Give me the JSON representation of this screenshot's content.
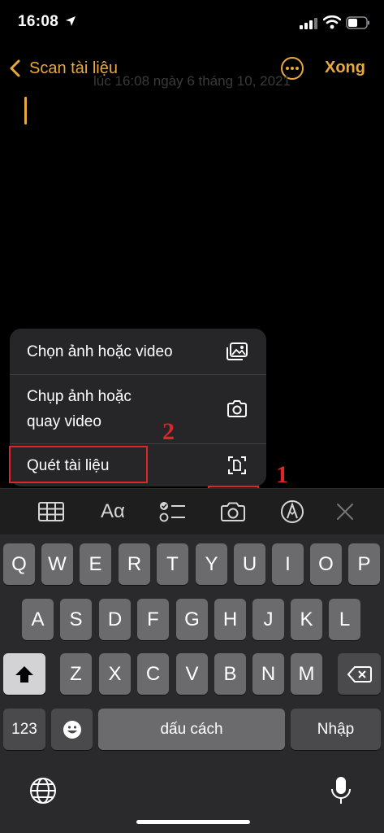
{
  "status_bar": {
    "time": "16:08"
  },
  "nav": {
    "back_label": "Scan tài liệu",
    "done_label": "Xong"
  },
  "note": {
    "date_text": "lúc 16:08 ngày 6 tháng 10, 2021"
  },
  "menu": {
    "items": [
      {
        "label": "Chọn ảnh hoặc video",
        "icon": "photo-library-icon"
      },
      {
        "label": "Chụp ảnh hoặc\nquay video",
        "icon": "camera-icon"
      },
      {
        "label": "Quét tài liệu",
        "icon": "scan-document-icon"
      }
    ]
  },
  "annotations": {
    "step1": "1",
    "step2": "2",
    "color": "#e0242b"
  },
  "toolbar": {
    "format_label": "Aα"
  },
  "keyboard": {
    "row1": [
      "Q",
      "W",
      "E",
      "R",
      "T",
      "Y",
      "U",
      "I",
      "O",
      "P"
    ],
    "row2": [
      "A",
      "S",
      "D",
      "F",
      "G",
      "H",
      "J",
      "K",
      "L"
    ],
    "row3": [
      "Z",
      "X",
      "C",
      "V",
      "B",
      "N",
      "M"
    ],
    "numbers_label": "123",
    "space_label": "dấu cách",
    "return_label": "Nhập"
  },
  "colors": {
    "accent": "#e9a93c",
    "background": "#000000"
  }
}
